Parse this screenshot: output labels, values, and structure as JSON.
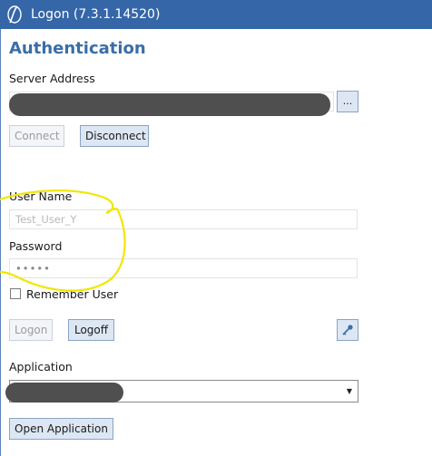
{
  "window": {
    "title": "Logon (7.3.1.14520)",
    "app_icon": "logo-icon"
  },
  "auth": {
    "heading": "Authentication",
    "server_label": "Server Address",
    "server_value": "",
    "browse_label": "...",
    "connect_label": "Connect",
    "disconnect_label": "Disconnect",
    "username_label": "User Name",
    "username_placeholder": "Test_User_Y",
    "password_label": "Password",
    "password_value": "•••••",
    "remember_label": "Remember User",
    "remember_checked": false,
    "logon_label": "Logon",
    "logoff_label": "Logoff",
    "key_icon": "key-icon"
  },
  "application": {
    "label": "Application",
    "selected": "",
    "open_label": "Open Application"
  },
  "colors": {
    "titlebar": "#3566a8",
    "heading": "#3a6ea8",
    "button_bg": "#dde7f4",
    "button_border": "#8aa3c4",
    "redaction": "#4f4f4f",
    "annotation": "#f2e600"
  }
}
